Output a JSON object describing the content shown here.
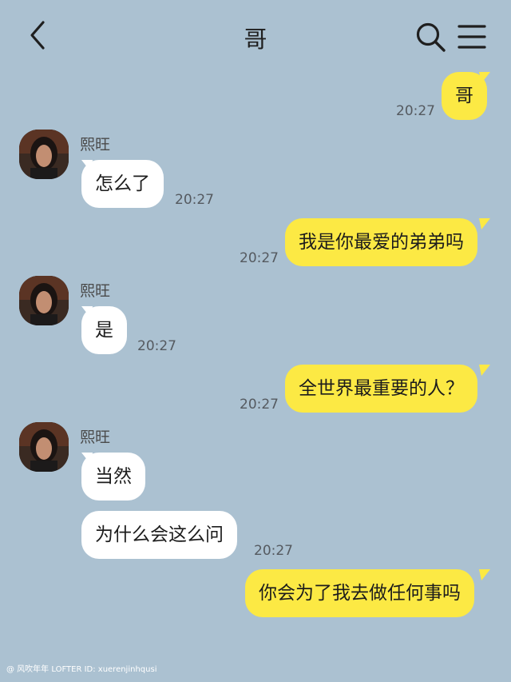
{
  "header": {
    "title": "哥"
  },
  "contact": {
    "name": "熙旺"
  },
  "messages": [
    {
      "side": "out",
      "text": "哥",
      "time": "20:27"
    },
    {
      "side": "in",
      "text": "怎么了",
      "time": "20:27"
    },
    {
      "side": "out",
      "text": "我是你最爱的弟弟吗",
      "time": "20:27"
    },
    {
      "side": "in",
      "text": "是",
      "time": "20:27"
    },
    {
      "side": "out",
      "text": "全世界最重要的人？",
      "time": "20:27"
    },
    {
      "side": "in",
      "text": "当然",
      "time": ""
    },
    {
      "side": "in",
      "text": "为什么会这么问",
      "time": "20:27"
    },
    {
      "side": "out",
      "text": "你会为了我去做任何事吗",
      "time": ""
    }
  ],
  "watermark": "@ 风吹年年  LOFTER ID: xuerenjinhqusi",
  "colors": {
    "background": "#abc1d1",
    "outgoing_bubble": "#fce944",
    "incoming_bubble": "#ffffff"
  }
}
